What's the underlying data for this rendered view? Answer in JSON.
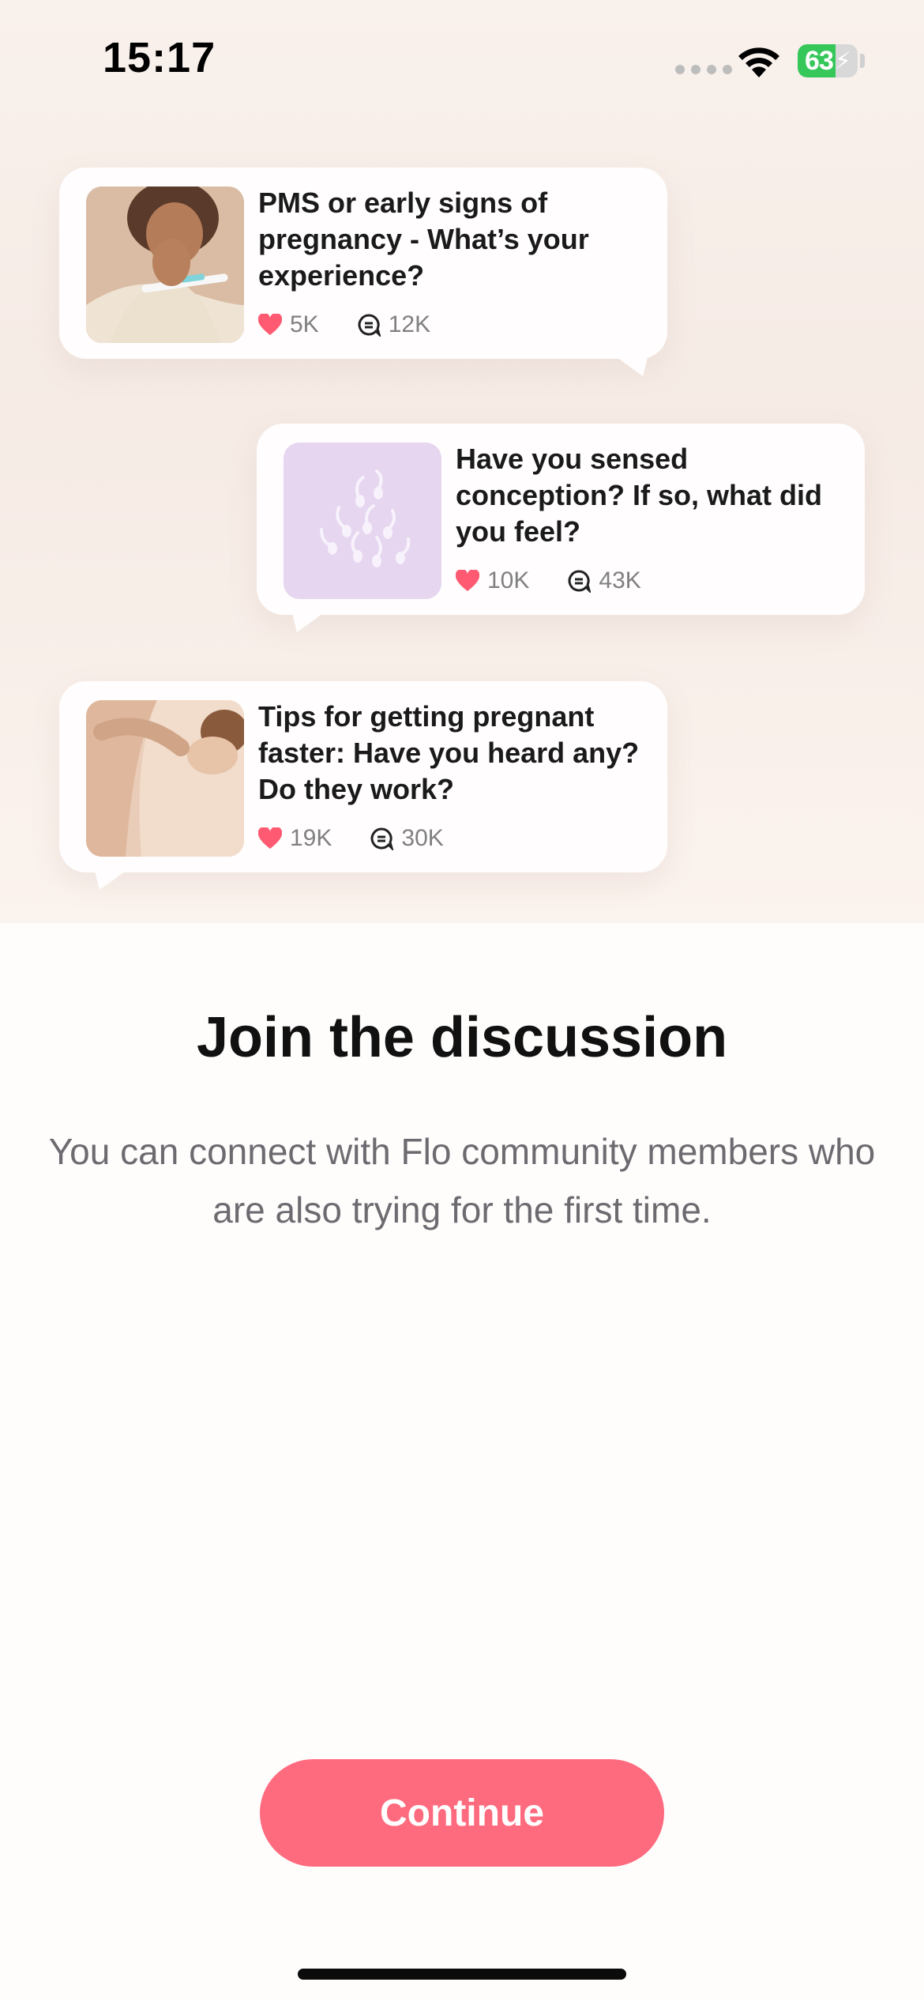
{
  "status_bar": {
    "time": "15:17",
    "battery_percent": 63,
    "battery_label": "63",
    "charging": true,
    "colors": {
      "battery": "#35c759"
    }
  },
  "posts": [
    {
      "title": "PMS or early signs of pregnancy - What’s your experience?",
      "likes": "5K",
      "comments": "12K",
      "image": "woman-holding-pregnancy-test"
    },
    {
      "title": "Have you sensed conception? If so, what did you feel?",
      "likes": "10K",
      "comments": "43K",
      "image": "sperm-illustration-lavender"
    },
    {
      "title": "Tips for getting pregnant faster: Have you heard any? Do they work?",
      "likes": "19K",
      "comments": "30K",
      "image": "couple-embrace"
    }
  ],
  "main": {
    "headline": "Join the discussion",
    "subtitle": "You can connect with Flo community members who are also trying for the first time.",
    "continue_label": "Continue"
  },
  "colors": {
    "accent": "#ff6b7e",
    "heart": "#ff5a72",
    "lavender": "#e6d6f0"
  }
}
